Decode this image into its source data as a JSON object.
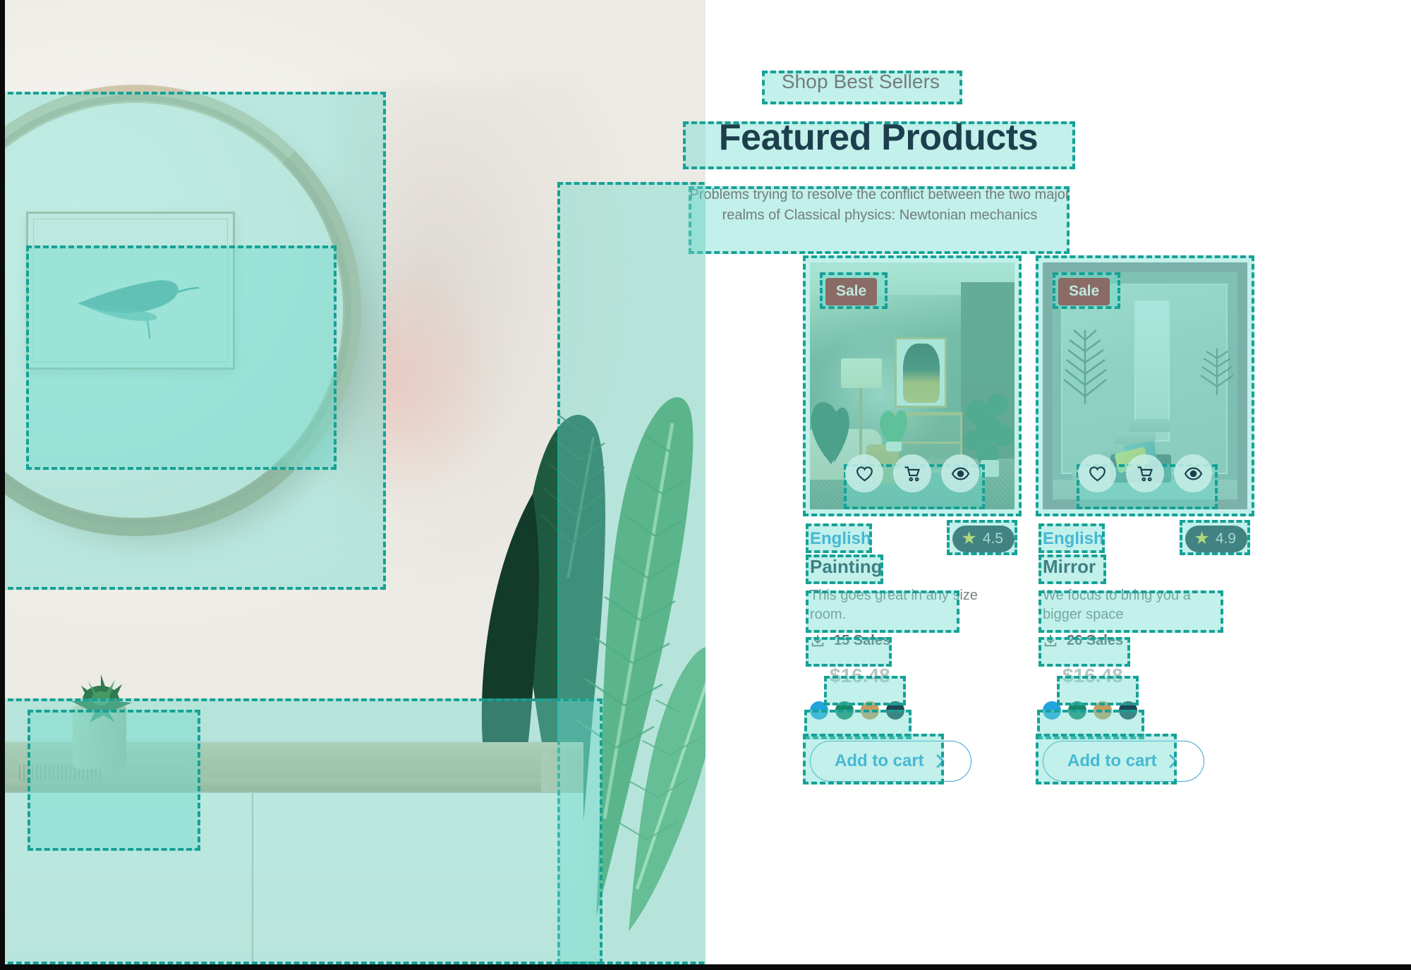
{
  "header": {
    "eyebrow": "Shop Best Sellers",
    "title": "Featured Products",
    "subtitle": "Problems trying to resolve the conflict between the two major realms of Classical physics: Newtonian mechanics"
  },
  "badges": {
    "sale_label": "Sale"
  },
  "icons": {
    "wishlist": "heart-icon",
    "cart": "cart-icon",
    "quickview": "eye-icon",
    "sales": "download-icon",
    "star": "star-icon",
    "chevron": "chevron-right-icon"
  },
  "colors": {
    "accent_blue": "#2a9fd8",
    "dark_teal": "#1d3f4d",
    "highlight_teal": "#17a196",
    "sale_badge": "#8a6b66",
    "star_yellow": "#ddd944",
    "muted_text": "#737d7e",
    "price_grey": "#b6c3c3"
  },
  "products": [
    {
      "sale_label": "Sale",
      "language": "English",
      "name": "Painting",
      "description": "This goes great in any size room.",
      "sales": "15 Sales",
      "price": "$16.48",
      "rating": "4.5",
      "cta": "Add to cart",
      "swatches": [
        "#23a3dd",
        "#17876a",
        "#c49a5e",
        "#1a4852"
      ]
    },
    {
      "sale_label": "Sale",
      "language": "English",
      "name": "Mirror",
      "description": "We focus to bring you a bigger space",
      "sales": "26 Sales",
      "price": "$16.48",
      "rating": "4.9",
      "cta": "Add to cart",
      "swatches": [
        "#23a3dd",
        "#17876a",
        "#c49a5e",
        "#1a4852"
      ]
    }
  ],
  "hero": {
    "alt_regions": [
      "mirror-region",
      "framed-art-region",
      "plant-region",
      "sideboard-region",
      "succulent-region"
    ]
  }
}
